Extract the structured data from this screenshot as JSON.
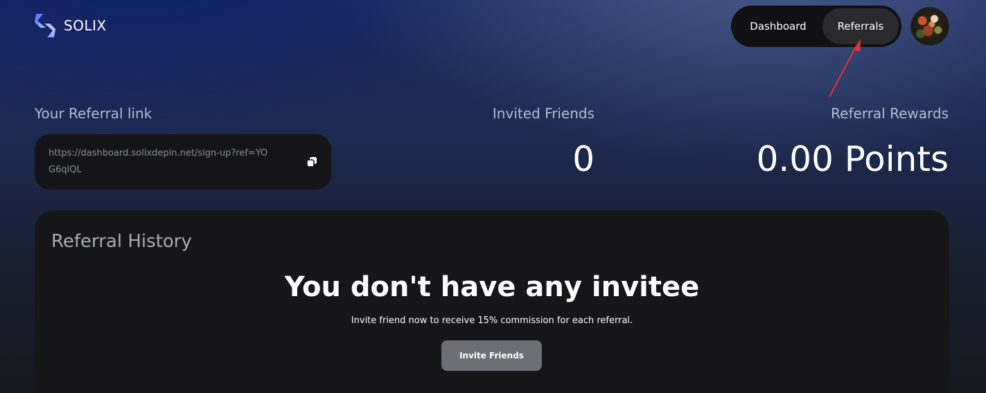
{
  "app": {
    "name": "SOLIX"
  },
  "nav": {
    "tabs": [
      {
        "label": "Dashboard",
        "active": false
      },
      {
        "label": "Referrals",
        "active": true
      }
    ]
  },
  "referral": {
    "link_label": "Your Referral link",
    "link_value": "https://dashboard.solixdepin.net/sign-up?ref=YOG6qlQL",
    "invited_label": "Invited Friends",
    "invited_value": "0",
    "rewards_label": "Referral Rewards",
    "rewards_value": "0.00 Points"
  },
  "history": {
    "title": "Referral History",
    "empty_title": "You don't have any invitee",
    "empty_subtitle": "Invite friend now to receive 15% commission for each referral.",
    "invite_button": "Invite Friends"
  },
  "icons": {
    "logo": "solix-logo-icon",
    "copy": "copy-icon",
    "avatar": "avatar"
  },
  "colors": {
    "accent_blue": "#5b7bff",
    "annotation_red": "#e8322a",
    "button_gray": "#6e6e76"
  }
}
